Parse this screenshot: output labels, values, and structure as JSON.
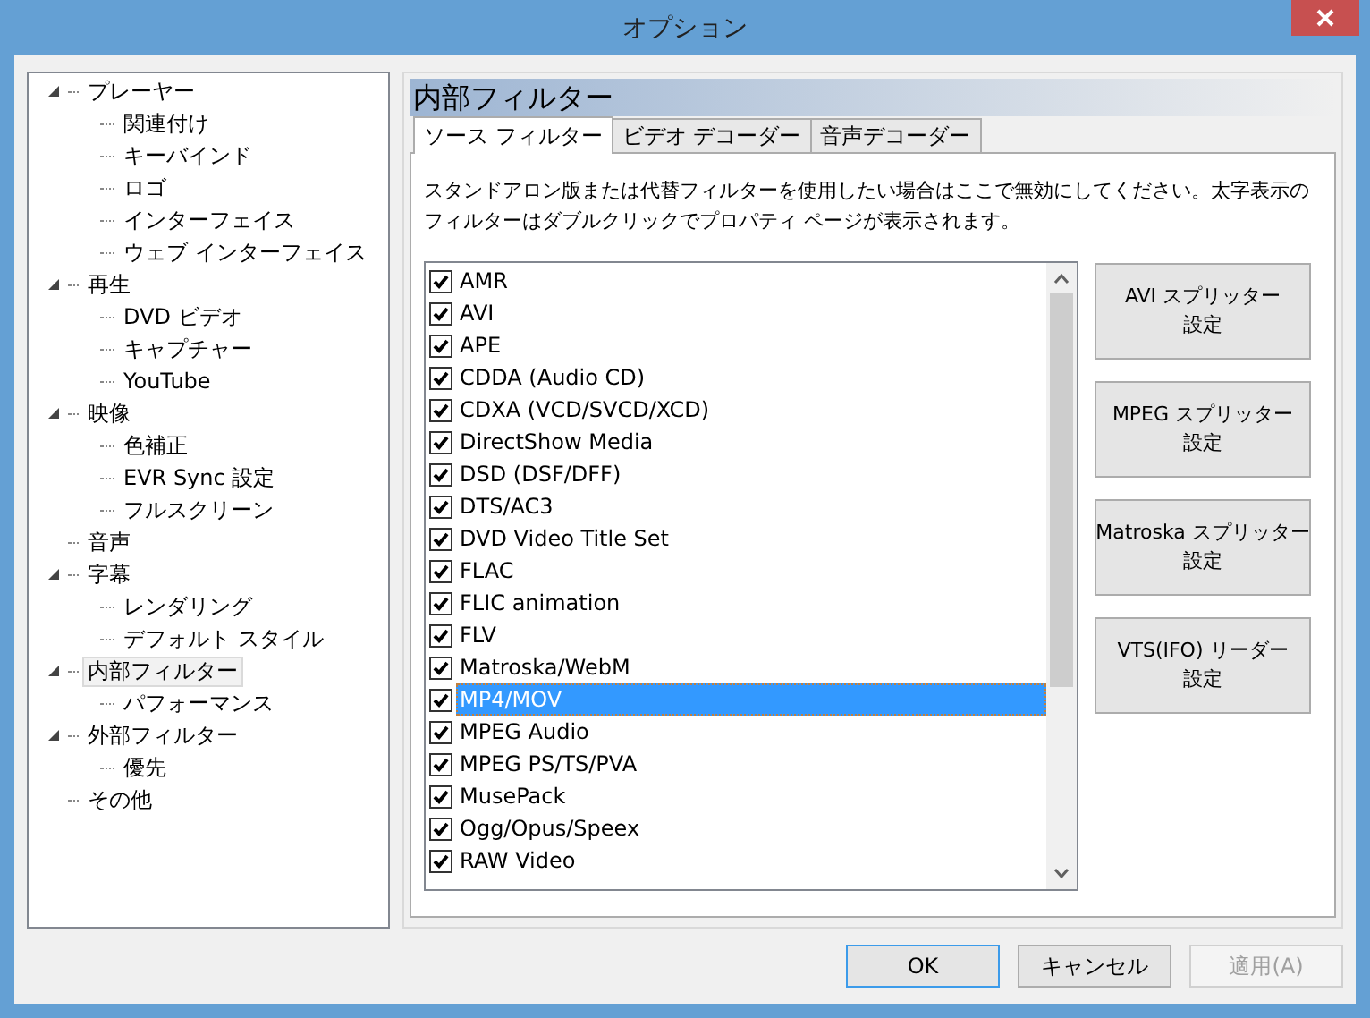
{
  "window": {
    "title": "オプション"
  },
  "tree": [
    {
      "label": "プレーヤー",
      "selected": false,
      "expanded": true,
      "children": [
        {
          "label": "関連付け",
          "selected": false
        },
        {
          "label": "キーバインド",
          "selected": false
        },
        {
          "label": "ロゴ",
          "selected": false
        },
        {
          "label": "インターフェイス",
          "selected": false
        },
        {
          "label": "ウェブ インターフェイス",
          "selected": false
        }
      ]
    },
    {
      "label": "再生",
      "selected": false,
      "expanded": true,
      "children": [
        {
          "label": "DVD ビデオ",
          "selected": false
        },
        {
          "label": "キャプチャー",
          "selected": false
        },
        {
          "label": "YouTube",
          "selected": false
        }
      ]
    },
    {
      "label": "映像",
      "selected": false,
      "expanded": true,
      "children": [
        {
          "label": "色補正",
          "selected": false
        },
        {
          "label": "EVR Sync 設定",
          "selected": false
        },
        {
          "label": "フルスクリーン",
          "selected": false
        }
      ]
    },
    {
      "label": "音声",
      "selected": false
    },
    {
      "label": "字幕",
      "selected": false,
      "expanded": true,
      "children": [
        {
          "label": "レンダリング",
          "selected": false
        },
        {
          "label": "デフォルト スタイル",
          "selected": false
        }
      ]
    },
    {
      "label": "内部フィルター",
      "selected": true,
      "expanded": true,
      "children": [
        {
          "label": "パフォーマンス",
          "selected": false
        }
      ]
    },
    {
      "label": "外部フィルター",
      "selected": false,
      "expanded": true,
      "children": [
        {
          "label": "優先",
          "selected": false
        }
      ]
    },
    {
      "label": "その他",
      "selected": false
    }
  ],
  "page": {
    "title": "内部フィルター",
    "tabs": [
      {
        "label": "ソース フィルター",
        "selected": true
      },
      {
        "label": "ビデオ デコーダー",
        "selected": false
      },
      {
        "label": "音声デコーダー",
        "selected": false
      }
    ],
    "description": "スタンドアロン版または代替フィルターを使用したい場合はここで無効にしてください。太字表示のフィルターはダブルクリックでプロパティ ページが表示されます。",
    "filters": [
      {
        "label": "AMR",
        "checked": true,
        "selected": false
      },
      {
        "label": "AVI",
        "checked": true,
        "selected": false
      },
      {
        "label": "APE",
        "checked": true,
        "selected": false
      },
      {
        "label": "CDDA (Audio CD)",
        "checked": true,
        "selected": false
      },
      {
        "label": "CDXA (VCD/SVCD/XCD)",
        "checked": true,
        "selected": false
      },
      {
        "label": "DirectShow Media",
        "checked": true,
        "selected": false
      },
      {
        "label": "DSD (DSF/DFF)",
        "checked": true,
        "selected": false
      },
      {
        "label": "DTS/AC3",
        "checked": true,
        "selected": false
      },
      {
        "label": "DVD Video Title Set",
        "checked": true,
        "selected": false
      },
      {
        "label": "FLAC",
        "checked": true,
        "selected": false
      },
      {
        "label": "FLIC animation",
        "checked": true,
        "selected": false
      },
      {
        "label": "FLV",
        "checked": true,
        "selected": false
      },
      {
        "label": "Matroska/WebM",
        "checked": true,
        "selected": false
      },
      {
        "label": "MP4/MOV",
        "checked": true,
        "selected": true
      },
      {
        "label": "MPEG Audio",
        "checked": true,
        "selected": false
      },
      {
        "label": "MPEG PS/TS/PVA",
        "checked": true,
        "selected": false
      },
      {
        "label": "MusePack",
        "checked": true,
        "selected": false
      },
      {
        "label": "Ogg/Opus/Speex",
        "checked": true,
        "selected": false
      },
      {
        "label": "RAW Video",
        "checked": true,
        "selected": false
      }
    ],
    "side_buttons": [
      {
        "line1": "AVI スプリッター",
        "line2": "設定"
      },
      {
        "line1": "MPEG スプリッター",
        "line2": "設定"
      },
      {
        "line1": "Matroska スプリッター",
        "line2": "設定"
      },
      {
        "line1": "VTS(IFO) リーダー",
        "line2": "設定"
      }
    ]
  },
  "buttons": [
    {
      "label": "OK",
      "kind": "default",
      "disabled": false
    },
    {
      "label": "キャンセル",
      "kind": "normal",
      "disabled": false
    },
    {
      "label": "適用(A)",
      "kind": "normal",
      "disabled": true
    }
  ]
}
